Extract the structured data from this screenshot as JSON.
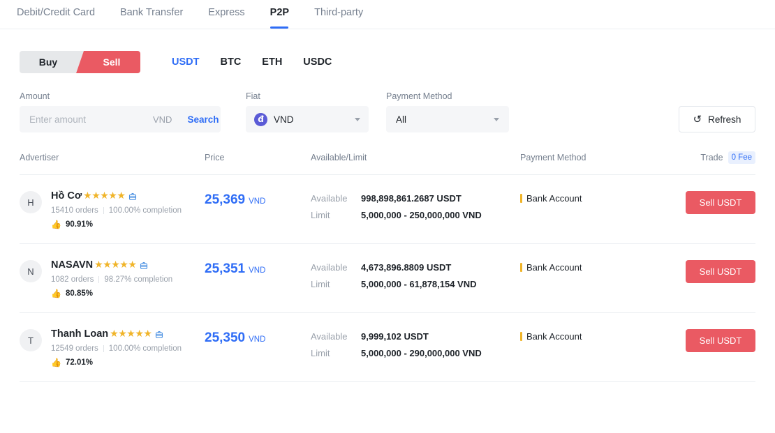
{
  "topnav": {
    "items": [
      {
        "label": "Debit/Credit Card",
        "active": false
      },
      {
        "label": "Bank Transfer",
        "active": false
      },
      {
        "label": "Express",
        "active": false
      },
      {
        "label": "P2P",
        "active": true
      },
      {
        "label": "Third-party",
        "active": false
      }
    ]
  },
  "side_toggle": {
    "buy_label": "Buy",
    "sell_label": "Sell",
    "selected": "Sell"
  },
  "coin_tabs": [
    {
      "label": "USDT",
      "active": true
    },
    {
      "label": "BTC",
      "active": false
    },
    {
      "label": "ETH",
      "active": false
    },
    {
      "label": "USDC",
      "active": false
    }
  ],
  "filters": {
    "amount": {
      "label": "Amount",
      "placeholder": "Enter amount",
      "value": "",
      "currency": "VND",
      "search_label": "Search"
    },
    "fiat": {
      "label": "Fiat",
      "value": "VND",
      "coin_glyph": "đ"
    },
    "payment_method": {
      "label": "Payment Method",
      "value": "All"
    },
    "refresh": {
      "label": "Refresh",
      "icon": "↺"
    }
  },
  "table": {
    "headers": {
      "advertiser": "Advertiser",
      "price": "Price",
      "available_limit": "Available/Limit",
      "payment_method": "Payment Method",
      "trade": "Trade",
      "fee_badge": "0 Fee"
    },
    "labels": {
      "available": "Available",
      "limit": "Limit"
    },
    "rows": [
      {
        "avatar": "H",
        "name": "Hồ Cơ",
        "stars": "★★★★★",
        "orders": "15410 orders",
        "completion": "100.00% completion",
        "rating": "90.91%",
        "price": "25,369",
        "price_currency": "VND",
        "available": "998,898,861.2687 USDT",
        "limit": "5,000,000 - 250,000,000 VND",
        "payment": "Bank Account",
        "action": "Sell USDT"
      },
      {
        "avatar": "N",
        "name": "NASAVN",
        "stars": "★★★★★",
        "orders": "1082 orders",
        "completion": "98.27% completion",
        "rating": "80.85%",
        "price": "25,351",
        "price_currency": "VND",
        "available": "4,673,896.8809 USDT",
        "limit": "5,000,000 - 61,878,154 VND",
        "payment": "Bank Account",
        "action": "Sell USDT"
      },
      {
        "avatar": "T",
        "name": "Thanh Loan",
        "stars": "★★★★★",
        "orders": "12549 orders",
        "completion": "100.00% completion",
        "rating": "72.01%",
        "price": "25,350",
        "price_currency": "VND",
        "available": "9,999,102 USDT",
        "limit": "5,000,000 - 290,000,000 VND",
        "payment": "Bank Account",
        "action": "Sell USDT"
      }
    ]
  },
  "colors": {
    "accent_blue": "#2f6df6",
    "sell_red": "#ea5a63",
    "star_yellow": "#f0b429",
    "thumb_green": "#20a464",
    "fiat_purple": "#5b5bd6"
  }
}
